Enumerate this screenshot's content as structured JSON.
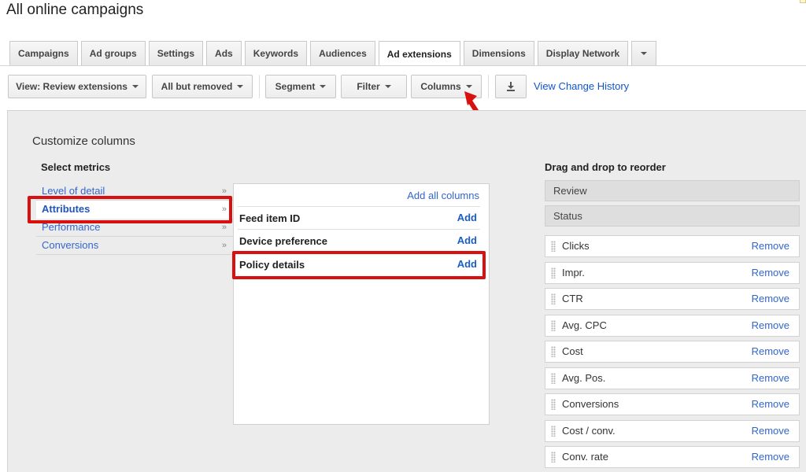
{
  "page_title": "All online campaigns",
  "tabs": [
    {
      "label": "Campaigns"
    },
    {
      "label": "Ad groups"
    },
    {
      "label": "Settings"
    },
    {
      "label": "Ads"
    },
    {
      "label": "Keywords"
    },
    {
      "label": "Audiences"
    },
    {
      "label": "Ad extensions",
      "active": true
    },
    {
      "label": "Dimensions"
    },
    {
      "label": "Display Network"
    }
  ],
  "toolbar": {
    "view_label": "View: Review extensions",
    "status_filter_label": "All but removed",
    "segment_label": "Segment",
    "filter_label": "Filter",
    "columns_label": "Columns",
    "download_icon": "download-icon",
    "change_history_label": "View Change History"
  },
  "customize": {
    "title": "Customize columns",
    "select_metrics_heading": "Select metrics",
    "categories": [
      "Level of detail",
      "Attributes",
      "Performance",
      "Conversions"
    ],
    "active_category": "Attributes",
    "add_all_label": "Add all columns",
    "metrics": [
      {
        "name": "Feed item ID",
        "action": "Add"
      },
      {
        "name": "Device preference",
        "action": "Add"
      },
      {
        "name": "Policy details",
        "action": "Add"
      }
    ],
    "reorder_heading": "Drag and drop to reorder",
    "fixed_columns": [
      "Review",
      "Status"
    ],
    "selected_columns": [
      "Clicks",
      "Impr.",
      "CTR",
      "Avg. CPC",
      "Cost",
      "Avg. Pos.",
      "Conversions",
      "Cost / conv.",
      "Conv. rate"
    ],
    "remove_label": "Remove"
  },
  "colors": {
    "highlight": "#d81010",
    "link": "#3366cc",
    "panel_bg": "#ececec"
  }
}
